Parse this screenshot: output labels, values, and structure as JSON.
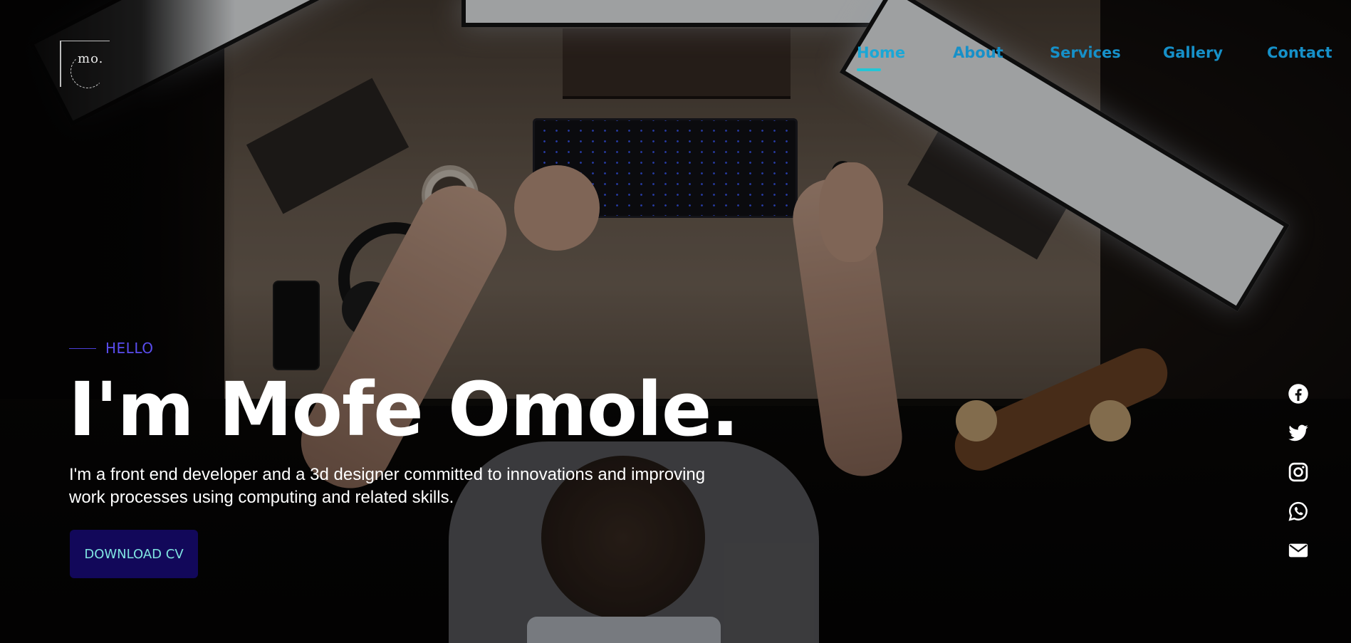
{
  "logo": {
    "mark": "mo."
  },
  "nav": {
    "items": [
      {
        "label": "Home",
        "active": true
      },
      {
        "label": "About"
      },
      {
        "label": "Services"
      },
      {
        "label": "Gallery"
      },
      {
        "label": "Contact"
      }
    ]
  },
  "hero": {
    "eyebrow": "HELLO",
    "title": "I'm Mofe Omole.",
    "subtitle": "I'm a front end developer and a 3d designer committed to innovations and improving work processes using computing and related skills.",
    "cta_label": "DOWNLOAD CV"
  },
  "social": [
    {
      "icon": "facebook-icon"
    },
    {
      "icon": "twitter-icon"
    },
    {
      "icon": "instagram-icon"
    },
    {
      "icon": "whatsapp-icon"
    },
    {
      "icon": "mail-icon"
    }
  ],
  "colors": {
    "nav_link": "#1690c8",
    "nav_active_underline": "#23c6d6",
    "eyebrow": "#5a4df0",
    "cta_bg": "#12085a",
    "cta_text": "#7fe4e1",
    "title": "#ffffff"
  }
}
